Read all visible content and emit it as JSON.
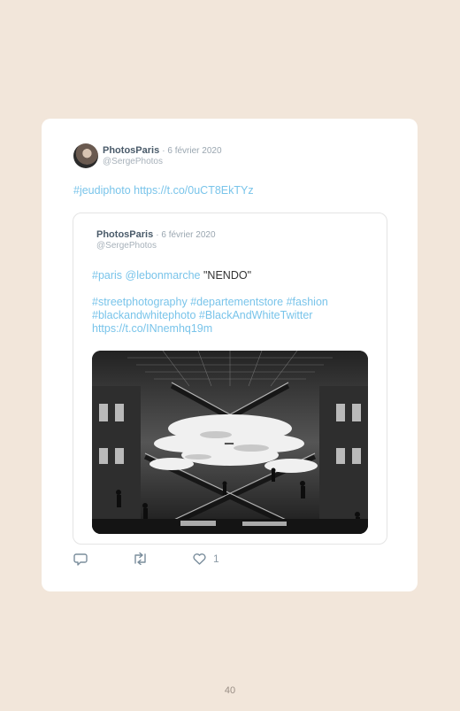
{
  "tweet": {
    "author_name": "PhotosParis",
    "date": "· 6 février 2020",
    "handle": "@SergePhotos",
    "hashtag": "#jeudiphoto",
    "link": "https://t.co/0uCT8EkTYz"
  },
  "quoted_tweet": {
    "author_name": "PhotosParis",
    "date": "· 6 février 2020",
    "handle": "@SergePhotos",
    "line1_tag": "#paris",
    "line1_mention": "@lebonmarche",
    "line1_text": "\"NENDO\"",
    "line2": "#streetphotography #departementstore #fashion",
    "line3": "#blackandwhitephoto #BlackAndWhiteTwitter",
    "line4": "https://t.co/INnemhq19m"
  },
  "actions": {
    "reply_icon": "comment-icon",
    "retweet_icon": "retweet-icon",
    "like_icon": "heart-icon",
    "like_count": "1"
  },
  "page_number": "40"
}
